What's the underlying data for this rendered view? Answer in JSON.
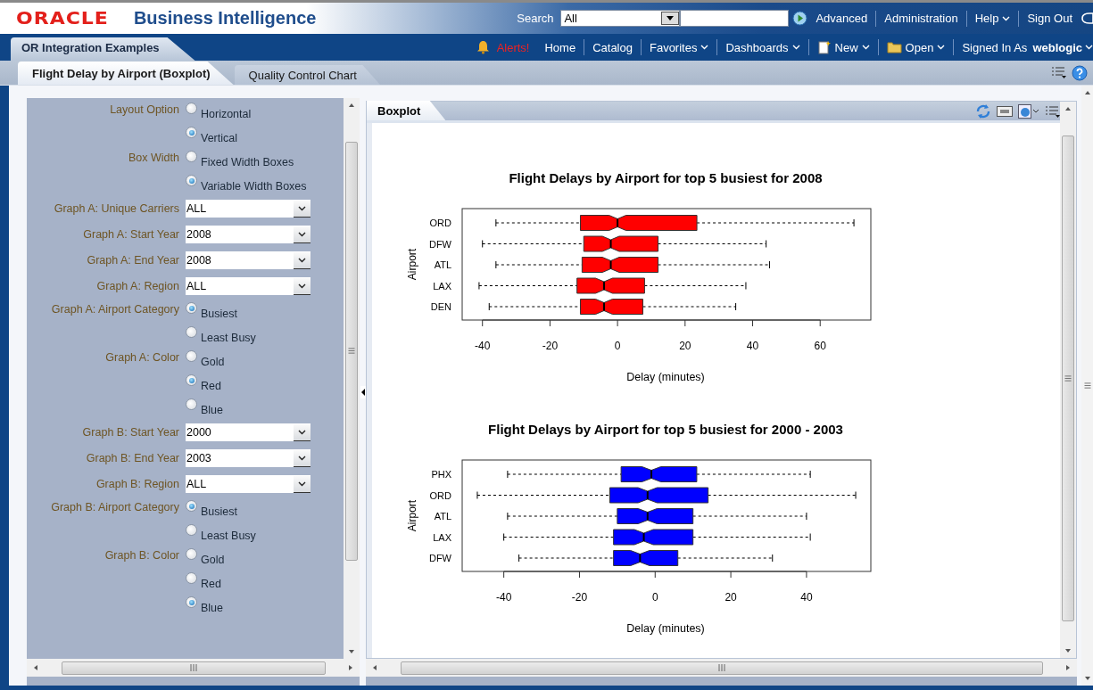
{
  "header": {
    "logo": "ORACLE",
    "product": "Business Intelligence",
    "search_label": "Search",
    "search_scope": "All",
    "links": [
      {
        "label": "Advanced",
        "dropdown": false
      },
      {
        "label": "Administration",
        "dropdown": false
      },
      {
        "label": "Help",
        "dropdown": true
      },
      {
        "label": "Sign Out",
        "dropdown": false
      }
    ]
  },
  "nav": {
    "dashboard": "OR Integration Examples",
    "alerts": "Alerts!",
    "links": [
      {
        "label": "Home",
        "dropdown": false,
        "kind": "plain"
      },
      {
        "label": "Catalog",
        "dropdown": false,
        "kind": "plain"
      },
      {
        "label": "Favorites",
        "dropdown": true,
        "kind": "plain"
      },
      {
        "label": "Dashboards",
        "dropdown": true,
        "kind": "plain"
      },
      {
        "label": "New",
        "dropdown": true,
        "kind": "new"
      },
      {
        "label": "Open",
        "dropdown": true,
        "kind": "folder"
      }
    ],
    "signed_in_label": "Signed In As",
    "user": "weblogic"
  },
  "page_tabs": [
    {
      "label": "Flight Delay by Airport (Boxplot)",
      "selected": true
    },
    {
      "label": "Quality Control Chart",
      "selected": false
    }
  ],
  "prompts": [
    {
      "kind": "radio",
      "label": "Layout Option",
      "options": [
        {
          "label": "Horizontal",
          "selected": false
        },
        {
          "label": "Vertical",
          "selected": true
        }
      ]
    },
    {
      "kind": "radio",
      "label": "Box Width",
      "options": [
        {
          "label": "Fixed Width Boxes",
          "selected": false
        },
        {
          "label": "Variable Width Boxes",
          "selected": true
        }
      ]
    },
    {
      "kind": "select",
      "label": "Graph A: Unique Carriers",
      "value": "ALL"
    },
    {
      "kind": "select",
      "label": "Graph A: Start Year",
      "value": "2008"
    },
    {
      "kind": "select",
      "label": "Graph A: End Year",
      "value": "2008"
    },
    {
      "kind": "select",
      "label": "Graph A: Region",
      "value": "ALL"
    },
    {
      "kind": "radio",
      "label": "Graph A: Airport Category",
      "options": [
        {
          "label": "Busiest",
          "selected": true
        },
        {
          "label": "Least Busy",
          "selected": false
        }
      ]
    },
    {
      "kind": "radio",
      "label": "Graph A: Color",
      "options": [
        {
          "label": "Gold",
          "selected": false
        },
        {
          "label": "Red",
          "selected": true
        },
        {
          "label": "Blue",
          "selected": false
        }
      ]
    },
    {
      "kind": "select",
      "label": "Graph B: Start Year",
      "value": "2000"
    },
    {
      "kind": "select",
      "label": "Graph B: End Year",
      "value": "2003"
    },
    {
      "kind": "select",
      "label": "Graph B: Region",
      "value": "ALL"
    },
    {
      "kind": "radio",
      "label": "Graph B: Airport Category",
      "options": [
        {
          "label": "Busiest",
          "selected": true
        },
        {
          "label": "Least Busy",
          "selected": false
        }
      ]
    },
    {
      "kind": "radio",
      "label": "Graph B: Color",
      "options": [
        {
          "label": "Gold",
          "selected": false
        },
        {
          "label": "Red",
          "selected": false
        },
        {
          "label": "Blue",
          "selected": true
        }
      ]
    }
  ],
  "report": {
    "tab": "Boxplot",
    "charts": [
      {
        "title": "Flight Delays by Airport for  top 5 busiest for 2008",
        "xlabel": "Delay (minutes)",
        "ylabel": "Airport",
        "color": "#ff0000",
        "categories": [
          "ORD",
          "DFW",
          "ATL",
          "LAX",
          "DEN"
        ],
        "tick_labels": [
          "-40",
          "-20",
          "0",
          "20",
          "40",
          "60"
        ]
      },
      {
        "title": "Flight Delays by Airport for  top 5 busiest for 2000 - 2003",
        "xlabel": "Delay (minutes)",
        "ylabel": "Airport",
        "color": "#0000ff",
        "categories": [
          "PHX",
          "ORD",
          "ATL",
          "LAX",
          "DFW"
        ],
        "tick_labels": [
          "-40",
          "-20",
          "0",
          "20",
          "40"
        ]
      }
    ]
  }
}
